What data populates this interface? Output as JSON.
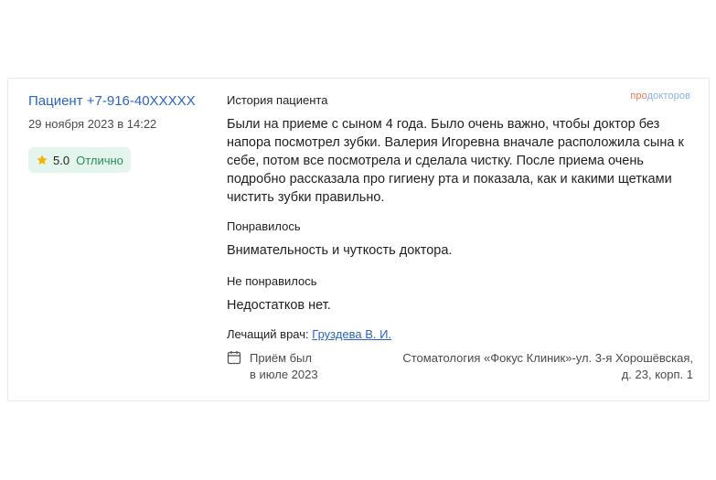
{
  "review": {
    "patient": "Пациент +7-916-40XXXXX",
    "date": "29 ноября 2023 в 14:22",
    "rating_score": "5.0",
    "rating_word": "Отлично",
    "brand_pro": "про",
    "brand_rest": "докторов",
    "history_title": "История пациента",
    "history_text": "Были на приеме с сыном 4 года. Было очень важно, чтобы доктор без напора посмотрел зубки. Валерия Игоревна вначале расположила сына к себе, потом все посмотрела и сделала чистку. После приема очень подробно рассказала про гигиену рта и показала, как и какими щетками чистить зубки правильно.",
    "liked_title": "Понравилось",
    "liked_text": "Внимательность и чуткость доктора.",
    "disliked_title": "Не понравилось",
    "disliked_text": "Недостатков нет.",
    "doctor_label": "Лечащий врач:",
    "doctor_name": "Груздева В. И.",
    "visit_line1": "Приём был",
    "visit_line2": "в июле 2023",
    "clinic_line1": "Стоматология «Фокус Клиник»-ул. 3-я Хорошёвская,",
    "clinic_line2": "д. 23, корп. 1"
  },
  "icons": {
    "star": "star-icon",
    "calendar": "calendar-icon"
  },
  "colors": {
    "link": "#2a64c4",
    "badge_bg": "#e4f5ee",
    "star": "#f5b400",
    "brand_pro": "#f07a5a",
    "brand_rest": "#8ab0e6"
  }
}
